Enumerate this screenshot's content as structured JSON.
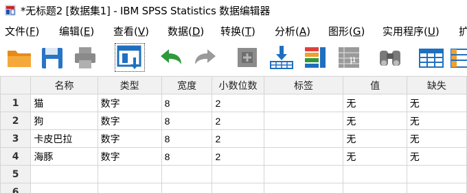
{
  "window": {
    "title": "*无标题2 [数据集1] - IBM SPSS Statistics 数据编辑器"
  },
  "menu": [
    {
      "pre": "文件(",
      "key": "F",
      "post": ")"
    },
    {
      "pre": "编辑(",
      "key": "E",
      "post": ")"
    },
    {
      "pre": "查看(",
      "key": "V",
      "post": ")"
    },
    {
      "pre": "数据(",
      "key": "D",
      "post": ")"
    },
    {
      "pre": "转换(",
      "key": "T",
      "post": ")"
    },
    {
      "pre": "分析(",
      "key": "A",
      "post": ")"
    },
    {
      "pre": "图形(",
      "key": "G",
      "post": ")"
    },
    {
      "pre": "实用程序(",
      "key": "U",
      "post": ")"
    },
    {
      "pre": "扩",
      "key": "",
      "post": ""
    }
  ],
  "toolbar": {
    "icons": [
      "open-folder-icon",
      "save-icon",
      "print-icon",
      "recall-dialog-icon",
      "undo-icon",
      "redo-icon",
      "go-to-case-icon",
      "go-to-variable-icon",
      "variables-icon",
      "run-descriptive-icon",
      "find-icon",
      "insert-cases-icon",
      "insert-variable-icon"
    ],
    "selected": "recall-dialog-icon"
  },
  "grid": {
    "headers": [
      "名称",
      "类型",
      "宽度",
      "小数位数",
      "标签",
      "值",
      "缺失"
    ],
    "rows": [
      {
        "num": "1",
        "cells": [
          "猫",
          "数字",
          "8",
          "2",
          "",
          "无",
          "无"
        ]
      },
      {
        "num": "2",
        "cells": [
          "狗",
          "数字",
          "8",
          "2",
          "",
          "无",
          "无"
        ]
      },
      {
        "num": "3",
        "cells": [
          "卡皮巴拉",
          "数字",
          "8",
          "2",
          "",
          "无",
          "无"
        ]
      },
      {
        "num": "4",
        "cells": [
          "海豚",
          "数字",
          "8",
          "2",
          "",
          "无",
          "无"
        ]
      },
      {
        "num": "5",
        "cells": [
          "",
          "",
          "",
          "",
          "",
          "",
          ""
        ]
      },
      {
        "num": "6",
        "cells": [
          "",
          "",
          "",
          "",
          "",
          "",
          ""
        ]
      }
    ]
  },
  "colors": {
    "grid_header_bg": "#f1f1f1",
    "grid_border": "#d4d4d4",
    "accent_blue": "#1f6fbf",
    "folder_orange": "#f0a030",
    "undo_green": "#2e9a3a"
  }
}
